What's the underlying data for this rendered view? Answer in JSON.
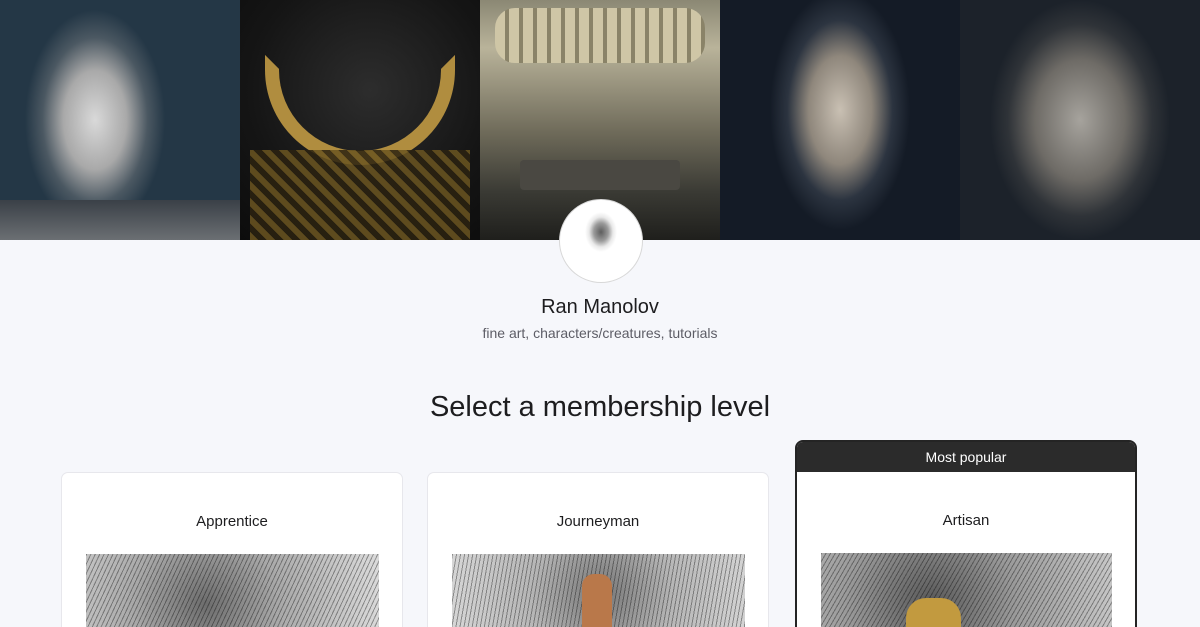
{
  "creator": {
    "name": "Ran Manolov",
    "description": "fine art, characters/creatures, tutorials"
  },
  "section": {
    "title": "Select a membership level"
  },
  "tiers": [
    {
      "name": "Apprentice",
      "badge": ""
    },
    {
      "name": "Journeyman",
      "badge": ""
    },
    {
      "name": "Artisan",
      "badge": "Most popular"
    }
  ],
  "colors": {
    "background": "#f6f7fb",
    "badge_background": "#2b2b2b",
    "card_background": "#ffffff"
  }
}
